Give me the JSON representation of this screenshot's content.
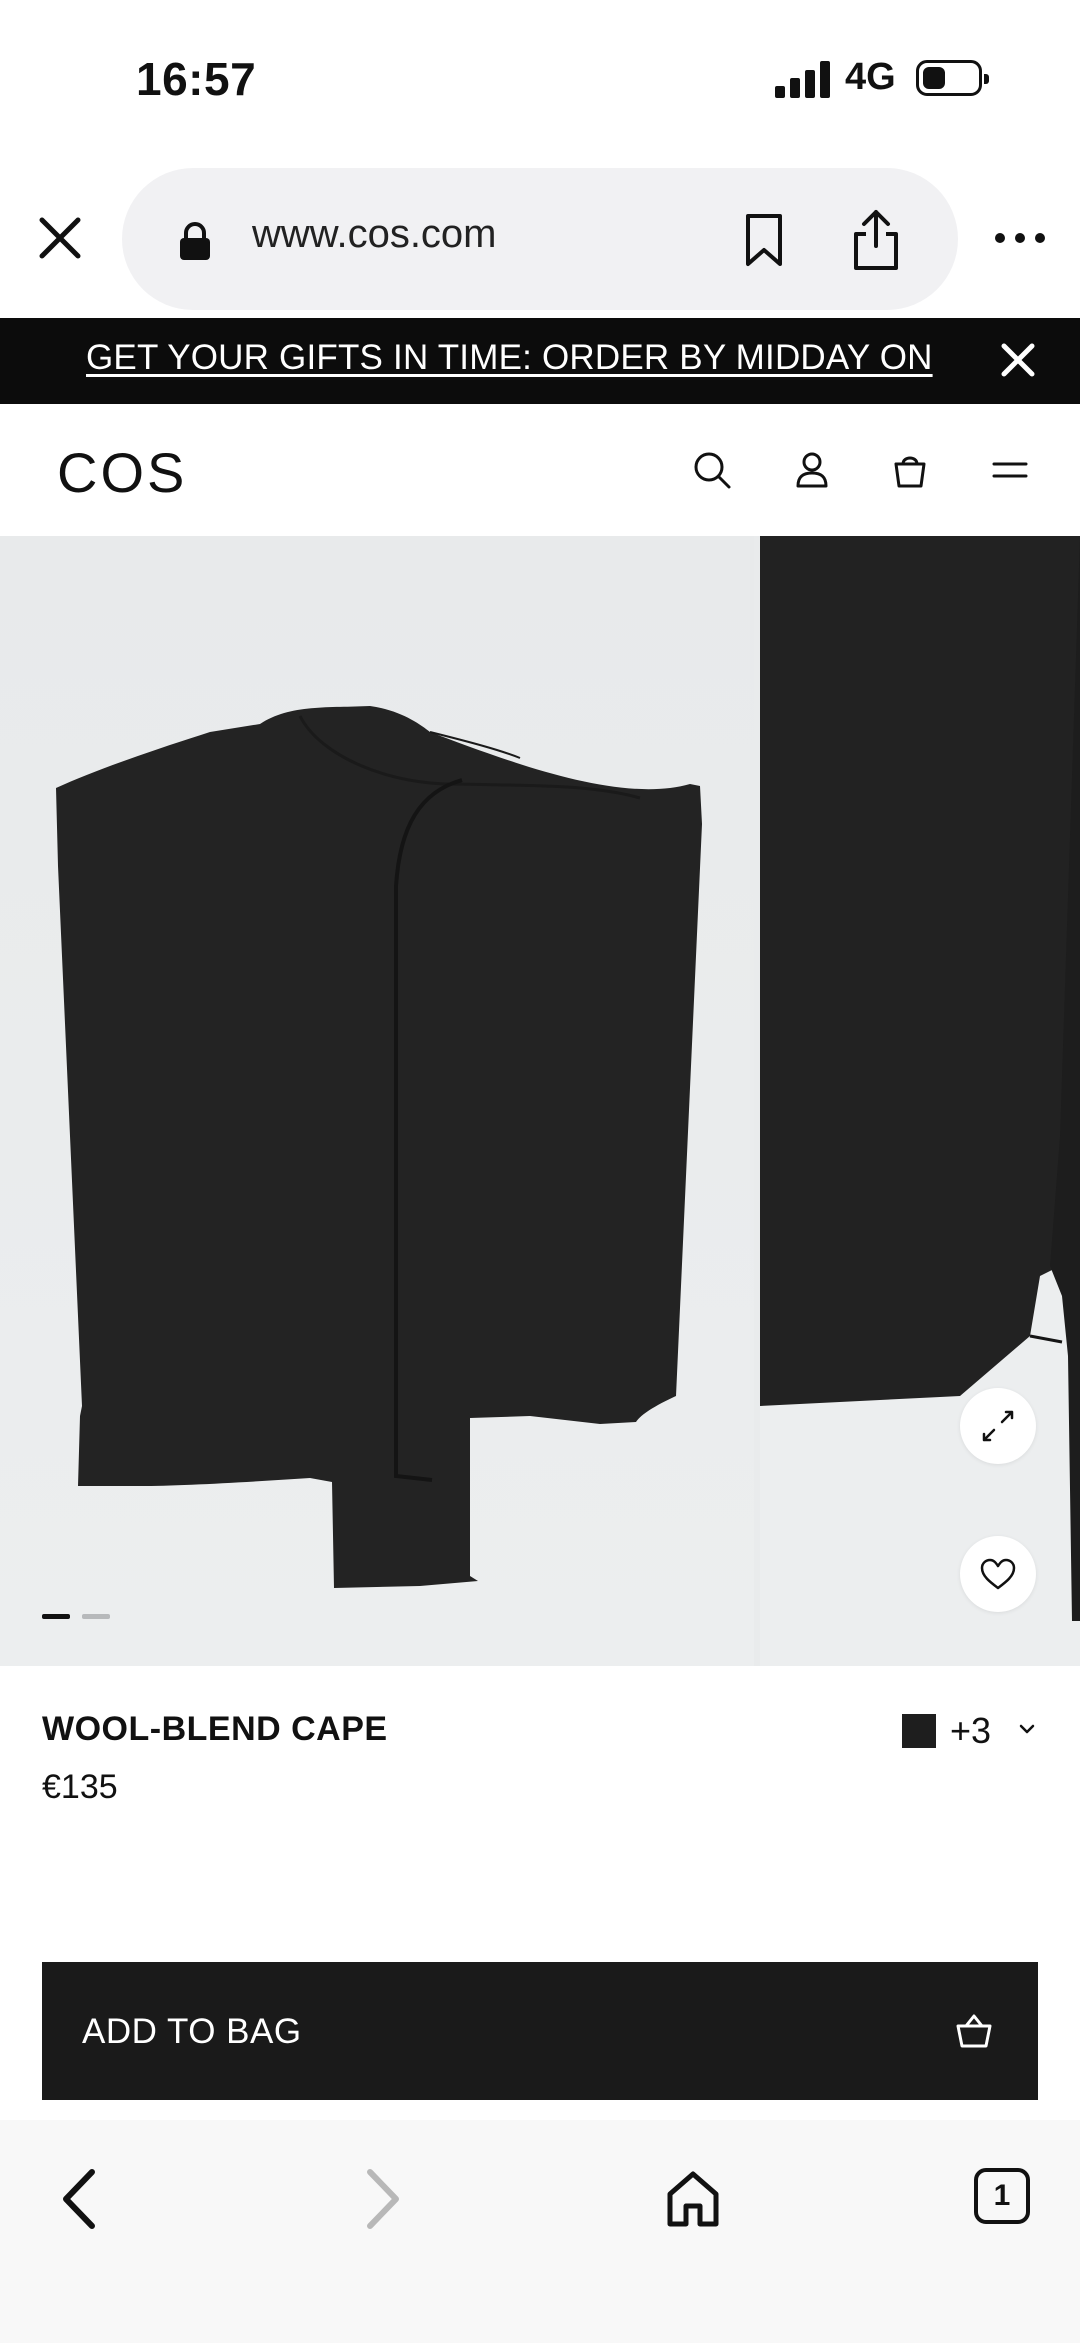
{
  "status_bar": {
    "time": "16:57",
    "network": "4G"
  },
  "browser": {
    "url": "www.cos.com",
    "tab_count": "1"
  },
  "promo": {
    "text": "GET YOUR GIFTS IN TIME: ORDER BY MIDDAY ON"
  },
  "site": {
    "logo": "COS"
  },
  "product": {
    "name": "WOOL-BLEND CAPE",
    "price": "€135",
    "more_colors": "+3",
    "selected_color": "#1e1e1e",
    "gallery_total": 2,
    "gallery_active": 1
  },
  "cta": {
    "add_to_bag_label": "ADD TO BAG"
  },
  "colors": {
    "banner_bg": "#0c0c0c",
    "button_bg": "#1a1a1a",
    "garment": "#232323",
    "gallery_bg": "#e9ebec"
  },
  "icons": {
    "toolbar": [
      "close-icon",
      "lock-icon",
      "bookmark-icon",
      "share-icon",
      "more-icon"
    ],
    "header": [
      "search-icon",
      "account-icon",
      "bag-icon",
      "menu-icon"
    ],
    "gallery": [
      "expand-icon",
      "heart-icon"
    ],
    "nav": [
      "back-icon",
      "forward-icon",
      "home-icon",
      "tabs-icon"
    ]
  }
}
